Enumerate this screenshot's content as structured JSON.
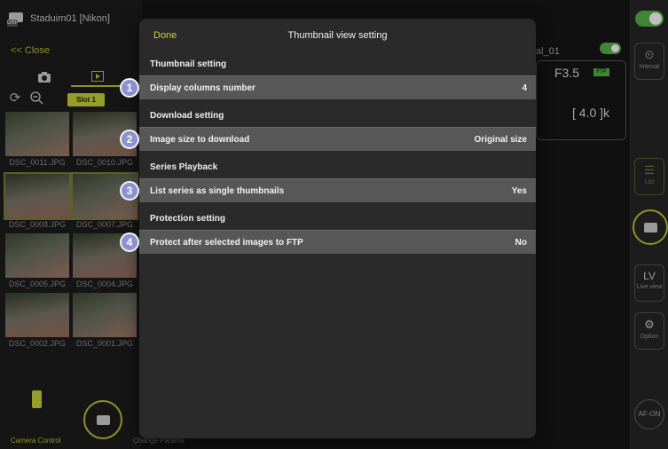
{
  "app": {
    "title": "Staduim01 [Nikon]",
    "close_label": "<< Close",
    "slot_label": "Slot 1"
  },
  "thumbnails": [
    {
      "name": "DSC_0011.JPG"
    },
    {
      "name": "DSC_0010.JPG"
    },
    {
      "name": "DSC_0008.JPG"
    },
    {
      "name": "DSC_0007.JPG"
    },
    {
      "name": "DSC_0005.JPG"
    },
    {
      "name": "DSC_0004.JPG"
    },
    {
      "name": "DSC_0002.JPG"
    },
    {
      "name": "DSC_0001.JPG"
    }
  ],
  "bottom_bar": {
    "camera_control_label": "Camera Control",
    "change_params_label": "Change Params"
  },
  "camera_info": {
    "file_suffix": "al_01",
    "aperture": "F3.5",
    "ftp_badge": "FTP",
    "count": "[ 4.0 ]k"
  },
  "right_rail": {
    "interval_label": "Interval",
    "list_label": "List",
    "live_view_glyph": "LV",
    "live_view_label": "Live view",
    "option_label": "Option",
    "af_on_label": "AF-ON"
  },
  "modal": {
    "done_label": "Done",
    "title": "Thumbnail view setting",
    "sections": [
      {
        "header": "Thumbnail setting",
        "row_label": "Display columns number",
        "row_value": "4",
        "marker": "1"
      },
      {
        "header": "Download setting",
        "row_label": "Image size to download",
        "row_value": "Original size",
        "marker": "2"
      },
      {
        "header": "Series Playback",
        "row_label": "List series as single thumbnails",
        "row_value": "Yes",
        "marker": "3"
      },
      {
        "header": "Protection setting",
        "row_label": "Protect after selected images to FTP",
        "row_value": "No",
        "marker": "4"
      }
    ]
  },
  "colors": {
    "accent": "#c8d23a",
    "marker": "#8a93cf",
    "toggle_on": "#57b248"
  }
}
